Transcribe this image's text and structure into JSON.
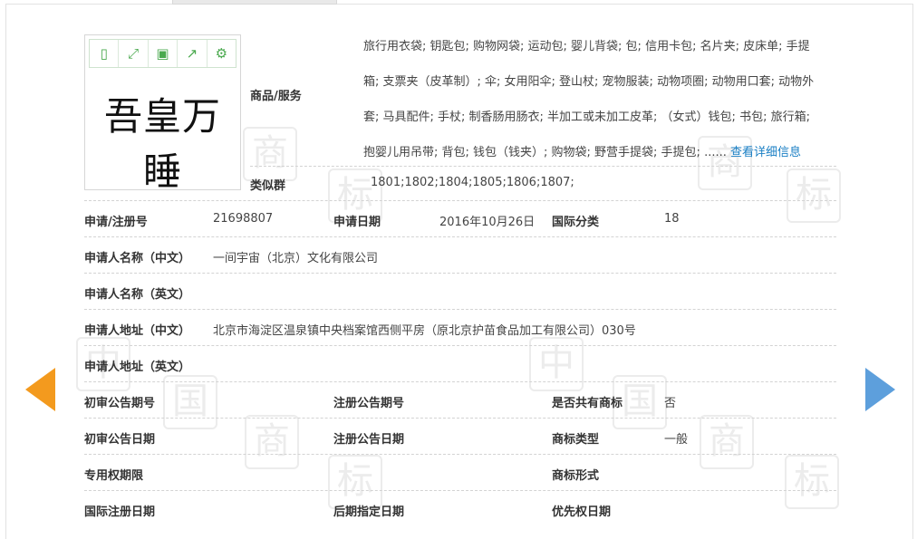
{
  "trademark": {
    "name": "吾皇万睡",
    "tools": [
      {
        "icon": "phone-icon",
        "glyph": "▯"
      },
      {
        "icon": "expand-icon",
        "glyph": "⤢"
      },
      {
        "icon": "save-icon",
        "glyph": "▣"
      },
      {
        "icon": "share-icon",
        "glyph": "↗"
      },
      {
        "icon": "gear-icon",
        "glyph": "⚙"
      }
    ]
  },
  "goods": {
    "label": "商品/服务",
    "lines": [
      "旅行用衣袋; 钥匙包; 购物网袋; 运动包; 婴儿背袋; 包; 信用卡包; 名片夹; 皮床单; 手提",
      "箱; 支票夹（皮革制）; 伞; 女用阳伞; 登山杖; 宠物服装; 动物项圈; 动物用口套; 动物外",
      "套; 马具配件; 手杖; 制香肠用肠衣; 半加工或未加工皮革; （女式）钱包; 书包; 旅行箱;",
      "抱婴儿用吊带; 背包; 钱包（钱夹）; 购物袋; 野营手提袋; 手提包; ......"
    ],
    "more_link": "查看详细信息"
  },
  "similar_group": {
    "label": "类似群",
    "value": "1801;1802;1804;1805;1806;1807;"
  },
  "fields": {
    "reg_no_label": "申请/注册号",
    "reg_no": "21698807",
    "app_date_label": "申请日期",
    "app_date": "2016年10月26日",
    "intl_class_label": "国际分类",
    "intl_class": "18",
    "applicant_cn_label": "申请人名称（中文）",
    "applicant_cn": "一间宇宙（北京）文化有限公司",
    "applicant_en_label": "申请人名称（英文）",
    "applicant_en": "",
    "address_cn_label": "申请人地址（中文）",
    "address_cn": "北京市海淀区温泉镇中央档案馆西侧平房（原北京护苗食品加工有限公司）030号",
    "address_en_label": "申请人地址（英文）",
    "address_en": "",
    "prelim_pub_no_label": "初审公告期号",
    "prelim_pub_no": "",
    "reg_pub_no_label": "注册公告期号",
    "reg_pub_no": "",
    "shared_label": "是否共有商标",
    "shared": "否",
    "prelim_pub_date_label": "初审公告日期",
    "prelim_pub_date": "",
    "reg_pub_date_label": "注册公告日期",
    "reg_pub_date": "",
    "tm_type_label": "商标类型",
    "tm_type": "一般",
    "exclusive_term_label": "专用权期限",
    "exclusive_term": "",
    "tm_form_label": "商标形式",
    "tm_form": "",
    "intl_reg_date_label": "国际注册日期",
    "intl_reg_date": "",
    "later_date_label": "后期指定日期",
    "later_date": "",
    "priority_date_label": "优先权日期",
    "priority_date": ""
  },
  "nav": {
    "prev_color": "#f39a1e",
    "next_color": "#5d9fdc"
  }
}
